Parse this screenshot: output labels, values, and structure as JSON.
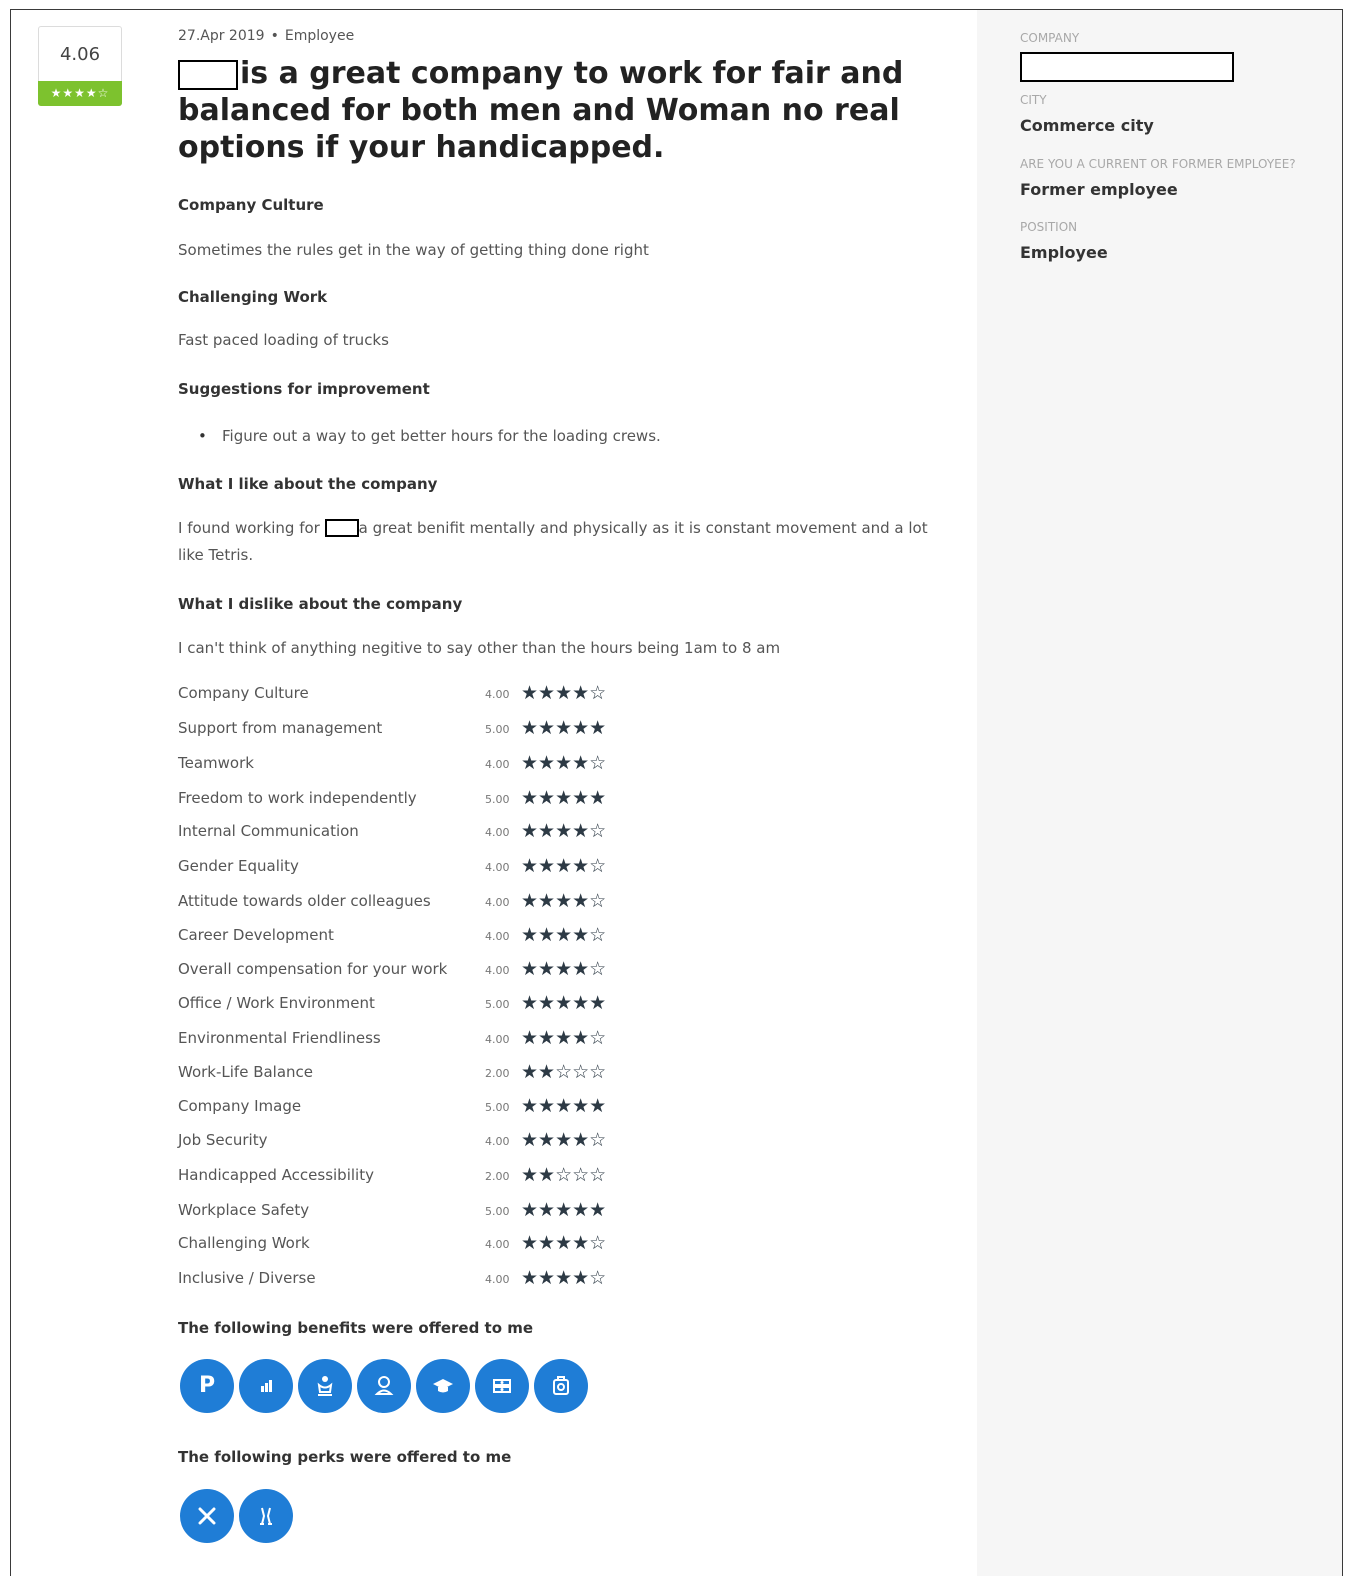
{
  "review": {
    "score": "4.06",
    "score_stars": "★★★★☆",
    "date": "27.Apr 2019",
    "separator": "•",
    "role": "Employee",
    "title_text": "is a great company to work for fair and balanced for both men and Woman no real options if your handicapped."
  },
  "sections": {
    "culture_heading": "Company Culture",
    "culture_text": "Sometimes the rules get in the way of getting thing done right",
    "challenging_heading": "Challenging Work",
    "challenging_text": "Fast paced loading of trucks",
    "suggestions_heading": "Suggestions for improvement",
    "suggestions": [
      "Figure out a way to get better hours for the loading crews."
    ],
    "like_heading": "What I like about the company",
    "like_text_before": "I found working for",
    "like_text_after": "a great benifit mentally and physically as it is constant movement and a lot like Tetris.",
    "dislike_heading": "What I dislike about the company",
    "dislike_text": "I can't think of anything negitive to say other than the hours being 1am to 8 am"
  },
  "ratings": [
    {
      "label": "Company Culture",
      "value": "4.00",
      "score": 4
    },
    {
      "label": "Support from management",
      "value": "5.00",
      "score": 5
    },
    {
      "label": "Teamwork",
      "value": "4.00",
      "score": 4
    },
    {
      "label": "Freedom to work independently",
      "value": "5.00",
      "score": 5
    },
    {
      "label": "Internal Communication",
      "value": "4.00",
      "score": 4
    },
    {
      "label": "Gender Equality",
      "value": "4.00",
      "score": 4
    },
    {
      "label": "Attitude towards older colleagues",
      "value": "4.00",
      "score": 4
    },
    {
      "label": "Career Development",
      "value": "4.00",
      "score": 4
    },
    {
      "label": "Overall compensation for your work",
      "value": "4.00",
      "score": 4
    },
    {
      "label": "Office / Work Environment",
      "value": "5.00",
      "score": 5
    },
    {
      "label": "Environmental Friendliness",
      "value": "4.00",
      "score": 4
    },
    {
      "label": "Work-Life Balance",
      "value": "2.00",
      "score": 2
    },
    {
      "label": "Company Image",
      "value": "5.00",
      "score": 5
    },
    {
      "label": "Job Security",
      "value": "4.00",
      "score": 4
    },
    {
      "label": "Handicapped Accessibility",
      "value": "2.00",
      "score": 2
    },
    {
      "label": "Workplace Safety",
      "value": "5.00",
      "score": 5
    },
    {
      "label": "Challenging Work",
      "value": "4.00",
      "score": 4
    },
    {
      "label": "Inclusive / Diverse",
      "value": "4.00",
      "score": 4
    }
  ],
  "benefits": {
    "heading": "The following benefits were offered to me",
    "icons": [
      "parking-icon",
      "bar-chart-icon",
      "childcare-icon",
      "user-badge-icon",
      "graduation-cap-icon",
      "money-icon",
      "first-aid-icon"
    ]
  },
  "perks": {
    "heading": "The following perks were offered to me",
    "icons": [
      "cutlery-icon",
      "celebration-icon"
    ]
  },
  "sidebar": {
    "company_label": "COMPANY",
    "city_label": "CITY",
    "city_value": "Commerce city",
    "employee_label": "ARE YOU A CURRENT OR FORMER EMPLOYEE?",
    "employee_value": "Former employee",
    "position_label": "POSITION",
    "position_value": "Employee"
  },
  "colors": {
    "accent_green": "#7dc22e",
    "icon_blue": "#1f7dd6",
    "star_dark": "#2d3a45"
  }
}
